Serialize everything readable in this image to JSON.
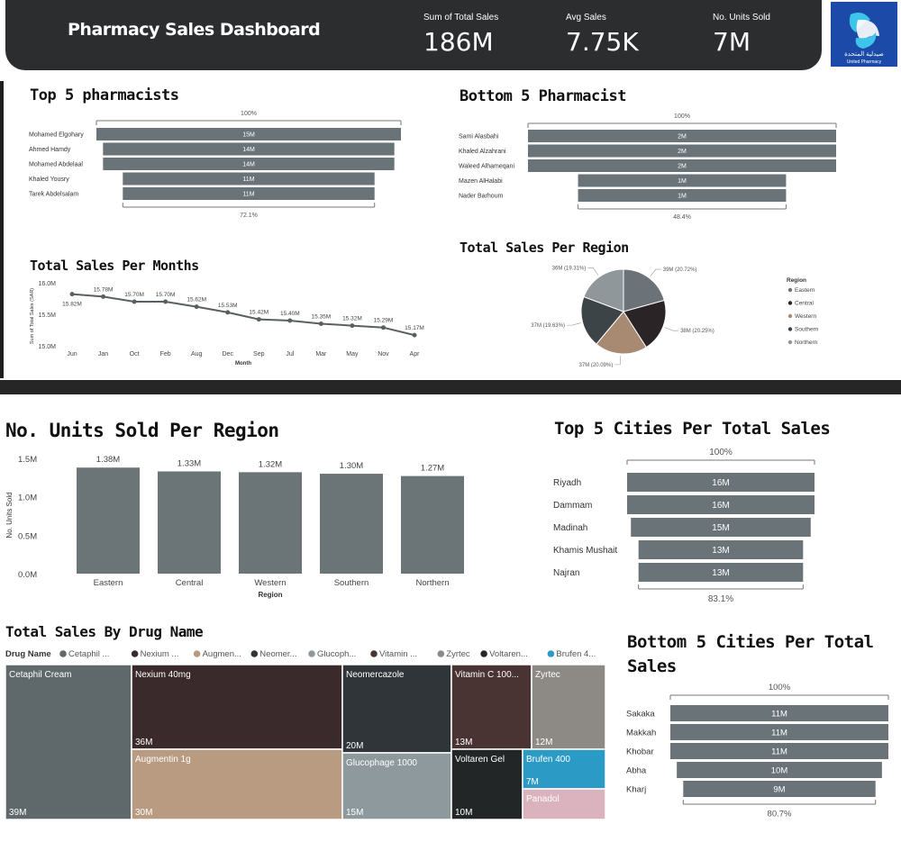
{
  "header": {
    "title": "Pharmacy Sales Dashboard",
    "kpis": [
      {
        "label": "Sum of Total Sales",
        "value": "186M"
      },
      {
        "label": "Avg Sales",
        "value": "7.75K"
      },
      {
        "label": "No. Units Sold",
        "value": "7M"
      }
    ],
    "logo_text": "صيدلية المتحدة",
    "logo_sub": "United Pharmacy"
  },
  "chart_data": [
    {
      "id": "top5-pharmacists",
      "type": "funnel",
      "title": "Top 5 pharmacists",
      "top_label": "100%",
      "bottom_label": "72.1%",
      "categories": [
        "Mohamed Elgohary",
        "Ahmed Hamdy",
        "Mohamed Abdelaal",
        "Khaled Yousry",
        "Tarek Abdelsalam"
      ],
      "values": [
        15,
        14,
        14,
        11,
        11
      ],
      "labels": [
        "15M",
        "14M",
        "14M",
        "11M",
        "11M"
      ]
    },
    {
      "id": "bottom5-pharmacist",
      "type": "funnel",
      "title": "Bottom 5 Pharmacist",
      "top_label": "100%",
      "bottom_label": "48.4%",
      "categories": [
        "Sami Alasbahi",
        "Khaled Alzahrani",
        "Waleed Alhameqani",
        "Mazen AlHalabi",
        "Nader Barhoum"
      ],
      "values": [
        2,
        2,
        2,
        1,
        1
      ],
      "labels": [
        "2M",
        "2M",
        "2M",
        "1M",
        "1M"
      ]
    },
    {
      "id": "sales-per-months",
      "type": "line",
      "title": "Total Sales Per Months",
      "xlabel": "Month",
      "ylabel": "Sum of Total Sales (SAR)",
      "yticks": [
        "16.0M",
        "15.5M",
        "15.0M"
      ],
      "ytick_values": [
        16.0,
        15.5,
        15.0
      ],
      "ylim": [
        15.0,
        16.0
      ],
      "categories": [
        "Jun",
        "Jan",
        "Oct",
        "Feb",
        "Aug",
        "Dec",
        "Sep",
        "Jul",
        "Mar",
        "May",
        "Nov",
        "Apr"
      ],
      "values": [
        15.82,
        15.78,
        15.7,
        15.7,
        15.62,
        15.53,
        15.42,
        15.4,
        15.35,
        15.32,
        15.29,
        15.17
      ],
      "labels": [
        "15.82M",
        "15.78M",
        "15.70M",
        "15.70M",
        "15.62M",
        "15.53M",
        "15.42M",
        "15.40M",
        "15.35M",
        "15.32M",
        "15.29M",
        "15.17M"
      ]
    },
    {
      "id": "sales-per-region",
      "type": "pie",
      "title": "Total Sales Per Region",
      "legend_title": "Region",
      "legend_position": "right",
      "slices": [
        {
          "name": "Eastern",
          "value": 20.72,
          "label": "39M (20.72%)",
          "color": "#6b7378"
        },
        {
          "name": "Central",
          "value": 20.25,
          "label": "38M (20.25%)",
          "color": "#2a2426"
        },
        {
          "name": "Western",
          "value": 20.09,
          "label": "37M (20.09%)",
          "color": "#a88a72"
        },
        {
          "name": "Southern",
          "value": 19.63,
          "label": "37M (19.63%)",
          "color": "#3c4447"
        },
        {
          "name": "Northern",
          "value": 19.31,
          "label": "36M (19.31%)",
          "color": "#8f979b"
        }
      ]
    },
    {
      "id": "units-per-region",
      "type": "bar",
      "title": "No. Units Sold Per Region",
      "xlabel": "Region",
      "ylabel": "No. Units Sold",
      "yticks": [
        "1.5M",
        "1.0M",
        "0.5M",
        "0.0M"
      ],
      "ytick_values": [
        1.5,
        1.0,
        0.5,
        0.0
      ],
      "ylim": [
        0,
        1.5
      ],
      "categories": [
        "Eastern",
        "Central",
        "Western",
        "Southern",
        "Northern"
      ],
      "values": [
        1.38,
        1.33,
        1.32,
        1.3,
        1.27
      ],
      "labels": [
        "1.38M",
        "1.33M",
        "1.32M",
        "1.30M",
        "1.27M"
      ]
    },
    {
      "id": "top5-cities",
      "type": "funnel",
      "title": "Top 5 Cities Per Total Sales",
      "top_label": "100%",
      "bottom_label": "83.1%",
      "categories": [
        "Riyadh",
        "Dammam",
        "Madinah",
        "Khamis Mushait",
        "Najran"
      ],
      "values": [
        16,
        16,
        15,
        13,
        13
      ],
      "labels": [
        "16M",
        "16M",
        "15M",
        "13M",
        "13M"
      ]
    },
    {
      "id": "bottom5-cities",
      "type": "funnel",
      "title": "Bottom 5 Cities Per Total Sales",
      "top_label": "100%",
      "bottom_label": "80.7%",
      "categories": [
        "Sakaka",
        "Makkah",
        "Khobar",
        "Abha",
        "Kharj"
      ],
      "values": [
        11,
        11,
        11,
        10,
        9
      ],
      "labels": [
        "11M",
        "11M",
        "11M",
        "10M",
        "9M"
      ]
    },
    {
      "id": "sales-by-drug",
      "type": "treemap",
      "title": "Total Sales By Drug Name",
      "legend_title": "Drug Name",
      "legend_items": [
        {
          "name": "Cetaphil ...",
          "color": "#5f686b"
        },
        {
          "name": "Nexium ...",
          "color": "#3a2a2b"
        },
        {
          "name": "Augmen...",
          "color": "#b99b82"
        },
        {
          "name": "Neomer...",
          "color": "#2f3538"
        },
        {
          "name": "Glucoph...",
          "color": "#8d999c"
        },
        {
          "name": "Vitamin ...",
          "color": "#4a3433"
        },
        {
          "name": "Zyrtec",
          "color": "#8d8a86"
        },
        {
          "name": "Voltaren...",
          "color": "#232627"
        },
        {
          "name": "Brufen 4...",
          "color": "#2b9ac4"
        },
        {
          "name": "Panadol",
          "color": "#dbb3bf"
        }
      ],
      "items": [
        {
          "name": "Cetaphil Cream",
          "label": "39M",
          "value": 39,
          "color": "#5f686b"
        },
        {
          "name": "Nexium 40mg",
          "label": "36M",
          "value": 36,
          "color": "#3a2a2b"
        },
        {
          "name": "Augmentin 1g",
          "label": "30M",
          "value": 30,
          "color": "#b99b82"
        },
        {
          "name": "Neomercazole",
          "label": "20M",
          "value": 20,
          "color": "#2f3538"
        },
        {
          "name": "Glucophage 1000",
          "label": "15M",
          "value": 15,
          "color": "#8d999c"
        },
        {
          "name": "Vitamin C 100...",
          "label": "13M",
          "value": 13,
          "color": "#4a3433"
        },
        {
          "name": "Zyrtec",
          "label": "12M",
          "value": 12,
          "color": "#8d8a86"
        },
        {
          "name": "Voltaren Gel",
          "label": "10M",
          "value": 10,
          "color": "#232627"
        },
        {
          "name": "Brufen 400",
          "label": "7M",
          "value": 7,
          "color": "#2b9ac4"
        },
        {
          "name": "Panadol",
          "label": "",
          "value": 5,
          "color": "#dbb3bf"
        }
      ]
    }
  ]
}
